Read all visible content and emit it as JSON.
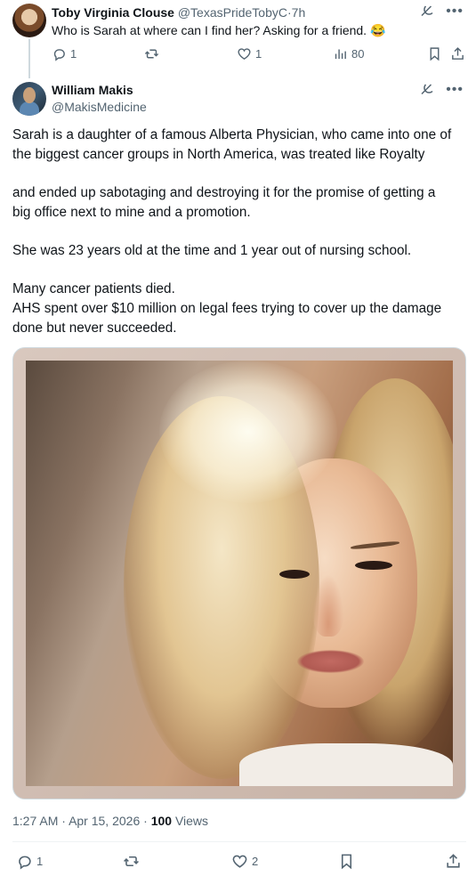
{
  "reply": {
    "author_name": "Toby Virginia Clouse",
    "author_handle": "@TexasPrideTobyC",
    "separator": "·",
    "time": "7h",
    "text": "Who is Sarah at where can I find her? Asking for a friend. 😂",
    "actions": {
      "replies": "1",
      "likes": "1",
      "views": "80"
    }
  },
  "main": {
    "author_name": "William Makis",
    "author_handle": "@MakisMedicine",
    "paragraphs": [
      [
        "Sarah is a daughter of a famous Alberta Physician, who came into one of",
        "the biggest cancer groups in North America, was treated like Royalty"
      ],
      [
        "and ended up sabotaging and destroying it for the promise of getting a",
        "big office next to mine and a promotion."
      ],
      [
        "She was 23 years old at the time and 1 year out of nursing school."
      ],
      [
        "Many cancer patients died.",
        "AHS spent over $10 million on legal fees trying to cover up the damage",
        "done but never succeeded."
      ]
    ],
    "meta": {
      "time": "1:27 AM",
      "sep": "·",
      "date": "Apr 15, 2026",
      "views_count": "100",
      "views_label": "Views"
    },
    "actions": {
      "replies": "1",
      "likes": "2"
    }
  },
  "icons": {
    "more": "more-icon",
    "grok": "grok-icon"
  },
  "colors": {
    "text": "#0f1419",
    "secondary": "#536471",
    "border": "#cfd9de"
  }
}
